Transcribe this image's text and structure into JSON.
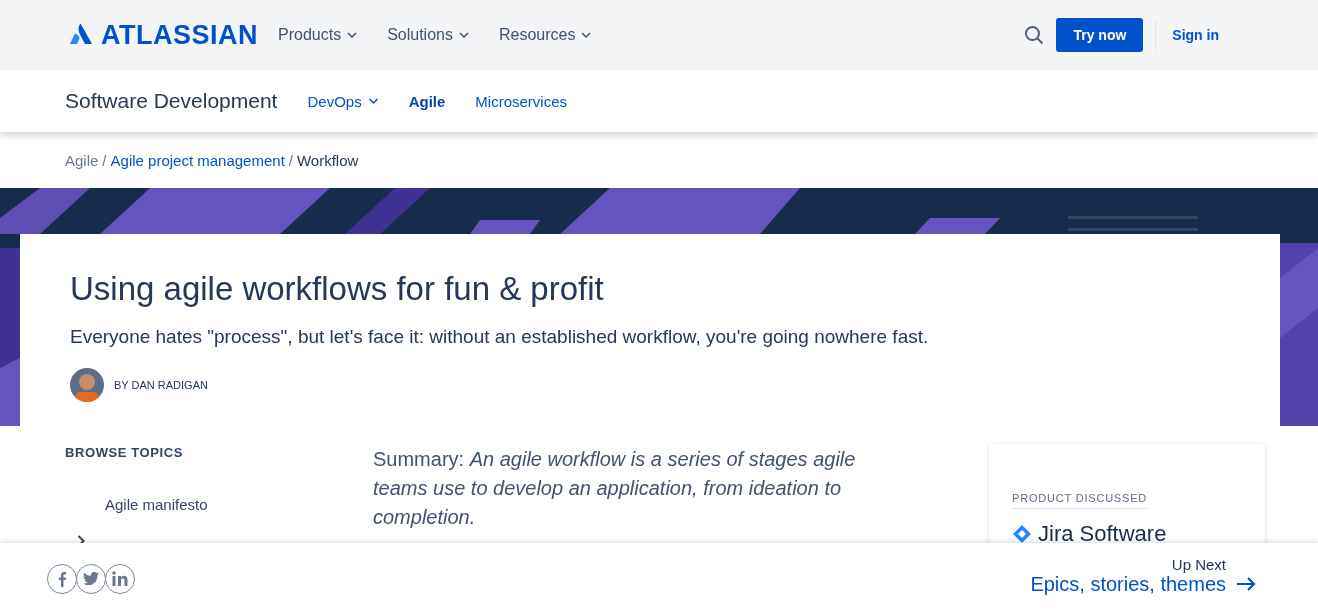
{
  "header": {
    "logo": "ATLASSIAN",
    "nav": [
      {
        "label": "Products",
        "has_menu": true
      },
      {
        "label": "Solutions",
        "has_menu": true
      },
      {
        "label": "Resources",
        "has_menu": true
      }
    ],
    "primary_button": "Try now",
    "sign_in": "Sign in"
  },
  "subnav": {
    "title": "Software Development",
    "items": [
      {
        "label": "DevOps",
        "has_menu": true,
        "selected": false
      },
      {
        "label": "Agile",
        "has_menu": false,
        "selected": true
      },
      {
        "label": "Microservices",
        "has_menu": false,
        "selected": false
      }
    ]
  },
  "breadcrumb_separator": "/",
  "breadcrumb": [
    {
      "label": "Agile",
      "kind": "muted"
    },
    {
      "label": "Agile project management",
      "kind": "link"
    },
    {
      "label": "Workflow",
      "kind": "current"
    }
  ],
  "hero": {
    "title": "Using agile workflows for fun & profit",
    "subtitle": "Everyone hates \"process\", but let's face it: without an established workflow, you're going nowhere fast.",
    "author": "BY DAN RADIGAN"
  },
  "sidebar": {
    "heading": "BROWSE TOPICS",
    "items": [
      {
        "label": "Agile manifesto",
        "kind": "plain"
      },
      {
        "kind": "expandable"
      }
    ]
  },
  "summary": "Summary: *An agile workflow is a series of stages agile teams use to develop an application, from ideation to completion.*",
  "product_card": {
    "heading": "PRODUCT DISCUSSED",
    "product": "Jira Software"
  },
  "footer": {
    "share": [
      {
        "kind": "facebook"
      },
      {
        "kind": "twitter"
      },
      {
        "kind": "linkedin"
      }
    ],
    "up_next_label": "Up Next",
    "up_next_link": "Epics, stories, themes"
  }
}
